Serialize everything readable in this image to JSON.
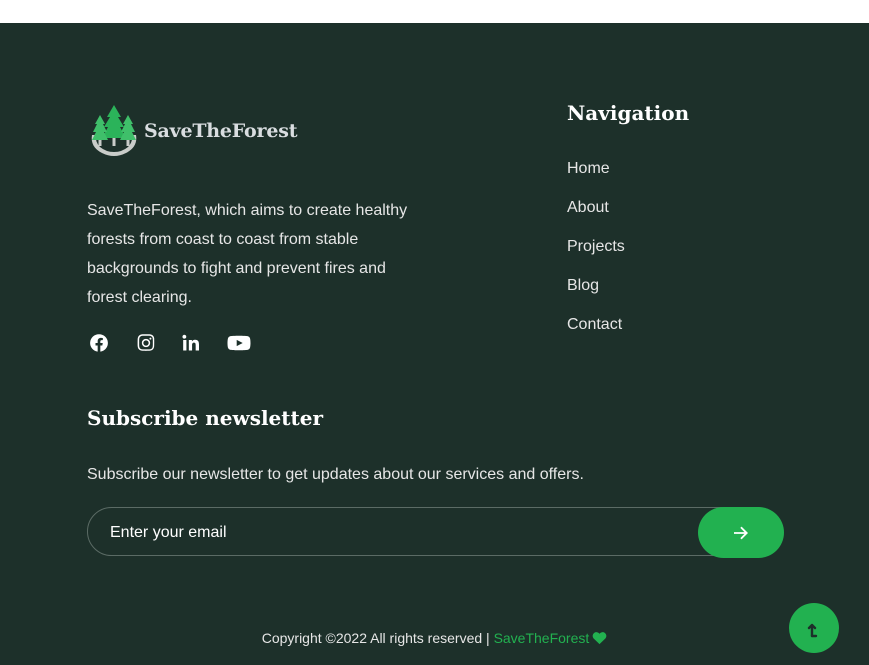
{
  "brand": {
    "name": "SaveTheForest",
    "description": "SaveTheForest, which aims to create healthy forests from coast to coast from stable backgrounds to fight and prevent fires and forest clearing."
  },
  "social": [
    {
      "icon": "facebook-icon"
    },
    {
      "icon": "instagram-icon"
    },
    {
      "icon": "linkedin-icon"
    },
    {
      "icon": "youtube-icon"
    }
  ],
  "navigation": {
    "title": "Navigation",
    "items": [
      "Home",
      "About",
      "Projects",
      "Blog",
      "Contact"
    ]
  },
  "newsletter": {
    "title": "Subscribe newsletter",
    "text": "Subscribe our newsletter to get updates about our services and offers.",
    "placeholder": "Enter your email",
    "button_icon": "arrow-right-icon"
  },
  "copyright": {
    "text": "Copyright ©2022 All rights reserved | ",
    "link": "SaveTheForest",
    "icon": "heart-icon"
  },
  "scroll_top": {
    "icon": "arrow-up-icon"
  },
  "colors": {
    "footer_bg": "#1d302a",
    "accent": "#22b150"
  }
}
